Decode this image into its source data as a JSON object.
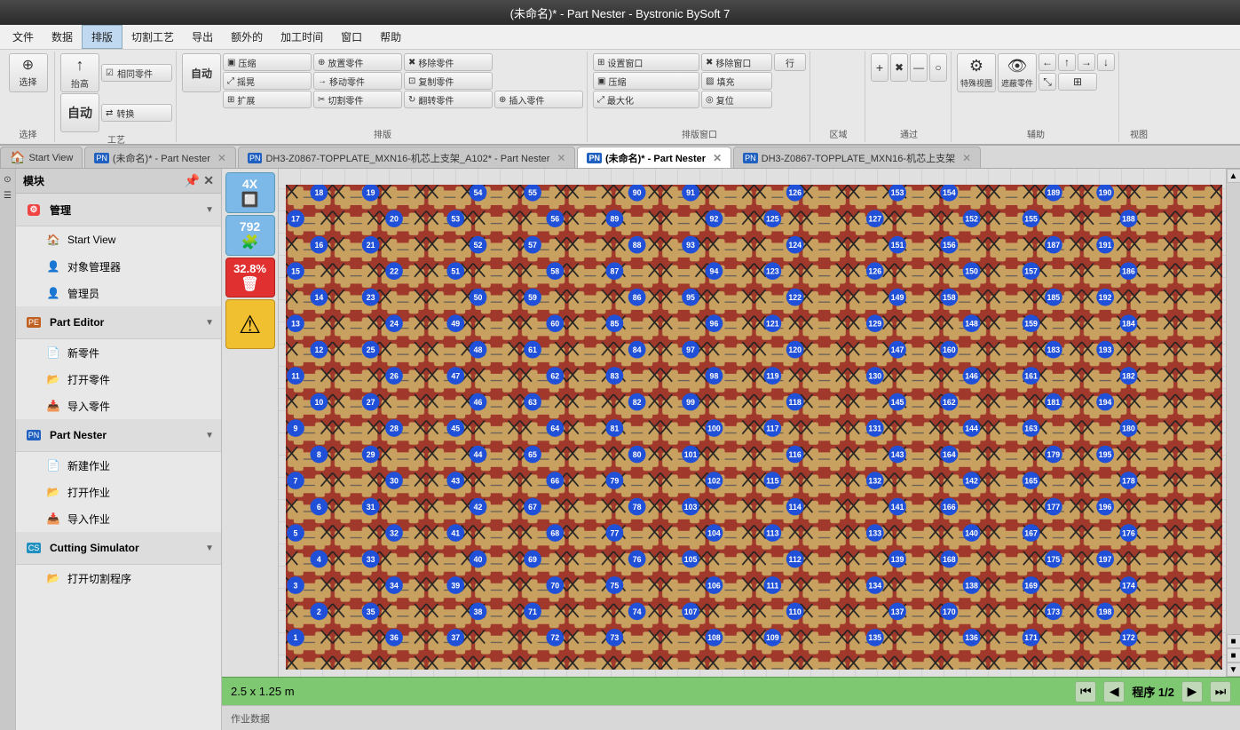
{
  "titlebar": {
    "text": "(未命名)* - Part Nester  - Bystronic BySoft 7"
  },
  "menubar": {
    "items": [
      "文件",
      "数据",
      "排版",
      "切割工艺",
      "导出",
      "额外的",
      "加工时间",
      "窗口",
      "帮助"
    ]
  },
  "toolbar": {
    "groups": [
      {
        "label": "选择",
        "buttons": [
          {
            "icon": "⊕",
            "text": "选择"
          },
          {
            "icon": "↑",
            "text": "抬高"
          },
          {
            "icon": "⇄",
            "text": "转换"
          },
          {
            "icon": "◎",
            "text": "自动"
          },
          {
            "icon": "🔧",
            "text": "自动"
          }
        ]
      },
      {
        "label": "工艺",
        "buttons": [
          {
            "icon": "▣",
            "text": "压缩"
          },
          {
            "icon": "⤢",
            "text": "摇晃"
          },
          {
            "icon": "⊞",
            "text": "扩展"
          },
          {
            "icon": "▣",
            "text": "相同零件"
          }
        ]
      },
      {
        "label": "排版",
        "buttons": [
          {
            "icon": "⊕",
            "text": "放置零件"
          },
          {
            "icon": "→",
            "text": "移动零件"
          },
          {
            "icon": "✂",
            "text": "切割零件"
          },
          {
            "icon": "↻",
            "text": "翻转零件"
          },
          {
            "icon": "✖",
            "text": "移除零件"
          },
          {
            "icon": "⊡",
            "text": "复制零件"
          },
          {
            "icon": "⊕",
            "text": "插入零件"
          }
        ]
      },
      {
        "label": "排版窗口",
        "buttons": [
          {
            "icon": "⊞",
            "text": "设置窗口"
          },
          {
            "icon": "▣",
            "text": "压缩"
          },
          {
            "icon": "⤢",
            "text": "最大化"
          },
          {
            "icon": "✖",
            "text": "移除窗口"
          },
          {
            "icon": "▨",
            "text": "填充"
          },
          {
            "icon": "◎",
            "text": "复位"
          },
          {
            "icon": "行",
            "text": "行"
          }
        ]
      },
      {
        "label": "区域",
        "buttons": []
      },
      {
        "label": "通过",
        "buttons": [
          {
            "icon": "+",
            "text": ""
          },
          {
            "icon": "✖",
            "text": ""
          },
          {
            "icon": "—",
            "text": ""
          },
          {
            "icon": "○",
            "text": ""
          },
          {
            "icon": "⬡",
            "text": ""
          }
        ]
      },
      {
        "label": "辅助",
        "buttons": [
          {
            "icon": "⚙",
            "text": "特殊视图"
          },
          {
            "icon": "👁",
            "text": "遮蔽零件"
          },
          {
            "icon": "←",
            "text": ""
          },
          {
            "icon": "↑",
            "text": ""
          },
          {
            "icon": "→",
            "text": ""
          },
          {
            "icon": "↓",
            "text": ""
          },
          {
            "icon": "⤡",
            "text": ""
          },
          {
            "icon": "⊞",
            "text": ""
          }
        ]
      },
      {
        "label": "视图",
        "buttons": []
      }
    ]
  },
  "tabs": [
    {
      "label": "Start View",
      "icon": "🏠",
      "active": false,
      "closable": false,
      "id": "start-view"
    },
    {
      "label": "(未命名)* - Part Nester",
      "icon": "PN",
      "active": false,
      "closable": true,
      "id": "unnamed-pn-1"
    },
    {
      "label": "DH3-Z0867-TOPPLATE_MXN16-机芯上支架_A102* - Part Nester",
      "icon": "PN",
      "active": false,
      "closable": true,
      "id": "dh3-pn"
    },
    {
      "label": "(未命名)* - Part Nester",
      "icon": "PN",
      "active": true,
      "closable": true,
      "id": "unnamed-pn-2"
    },
    {
      "label": "DH3-Z0867-TOPPLATE_MXN16-机芯上支架",
      "icon": "PN",
      "active": false,
      "closable": true,
      "id": "dh3-2"
    }
  ],
  "sidebar": {
    "title": "模块",
    "sections": [
      {
        "id": "management",
        "icon": "⚙",
        "icon_color": "#e44",
        "label": "管理",
        "items": [
          {
            "icon": "🏠",
            "label": "Start View"
          },
          {
            "icon": "👤",
            "label": "对象管理器"
          },
          {
            "icon": "👤",
            "label": "管理员"
          }
        ]
      },
      {
        "id": "part-editor",
        "icon": "PE",
        "icon_color": "#c06020",
        "label": "Part Editor",
        "items": [
          {
            "icon": "📄",
            "label": "新零件"
          },
          {
            "icon": "📂",
            "label": "打开零件"
          },
          {
            "icon": "📥",
            "label": "导入零件"
          }
        ]
      },
      {
        "id": "part-nester",
        "icon": "PN",
        "icon_color": "#2060c0",
        "label": "Part Nester",
        "items": [
          {
            "icon": "📄",
            "label": "新建作业"
          },
          {
            "icon": "📂",
            "label": "打开作业"
          },
          {
            "icon": "📥",
            "label": "导入作业"
          }
        ]
      },
      {
        "id": "cutting-simulator",
        "icon": "CS",
        "icon_color": "#2090c0",
        "label": "Cutting Simulator",
        "items": [
          {
            "icon": "📂",
            "label": "打开切割程序"
          }
        ]
      }
    ]
  },
  "left_panel": {
    "count_label": "4X",
    "parts_count": "792",
    "percentage": "32.8%",
    "warning": "⚠"
  },
  "plate": {
    "numbers": [
      18,
      19,
      54,
      55,
      90,
      91,
      126,
      153,
      154,
      189,
      190,
      17,
      20,
      53,
      56,
      89,
      92,
      125,
      127,
      152,
      155,
      188,
      16,
      21,
      52,
      57,
      88,
      93,
      124,
      151,
      156,
      187,
      191,
      15,
      22,
      51,
      58,
      87,
      94,
      123,
      150,
      157,
      186,
      14,
      23,
      50,
      59,
      86,
      95,
      122,
      149,
      158,
      185,
      192,
      13,
      24,
      49,
      60,
      85,
      96,
      121,
      129,
      148,
      159,
      184,
      12,
      25,
      48,
      61,
      84,
      97,
      120,
      147,
      160,
      183,
      193,
      11,
      26,
      47,
      62,
      83,
      98,
      119,
      130,
      146,
      161,
      182,
      10,
      27,
      46,
      63,
      82,
      99,
      118,
      145,
      162,
      181,
      194,
      9,
      28,
      45,
      64,
      81,
      100,
      117,
      131,
      144,
      163,
      180,
      8,
      29,
      44,
      65,
      80,
      101,
      116,
      143,
      164,
      179,
      195,
      7,
      30,
      43,
      66,
      79,
      102,
      115,
      132,
      142,
      165,
      178,
      6,
      31,
      42,
      67,
      78,
      103,
      114,
      141,
      166,
      177,
      196,
      5,
      32,
      41,
      68,
      77,
      104,
      113,
      133,
      140,
      167,
      176,
      4,
      33,
      40,
      69,
      76,
      105,
      112,
      139,
      168,
      175,
      197,
      3,
      34,
      39,
      70,
      75,
      106,
      111,
      134,
      138,
      169,
      174,
      2,
      35,
      38,
      71,
      74,
      107,
      110,
      137,
      170,
      173,
      198,
      1,
      36,
      37,
      72,
      73,
      108,
      109,
      135,
      136,
      171,
      172
    ]
  },
  "statusbar": {
    "dimensions": "2.5 x 1.25 m",
    "program": "程序 1/2"
  },
  "infobar": {
    "text": "作业数据"
  }
}
